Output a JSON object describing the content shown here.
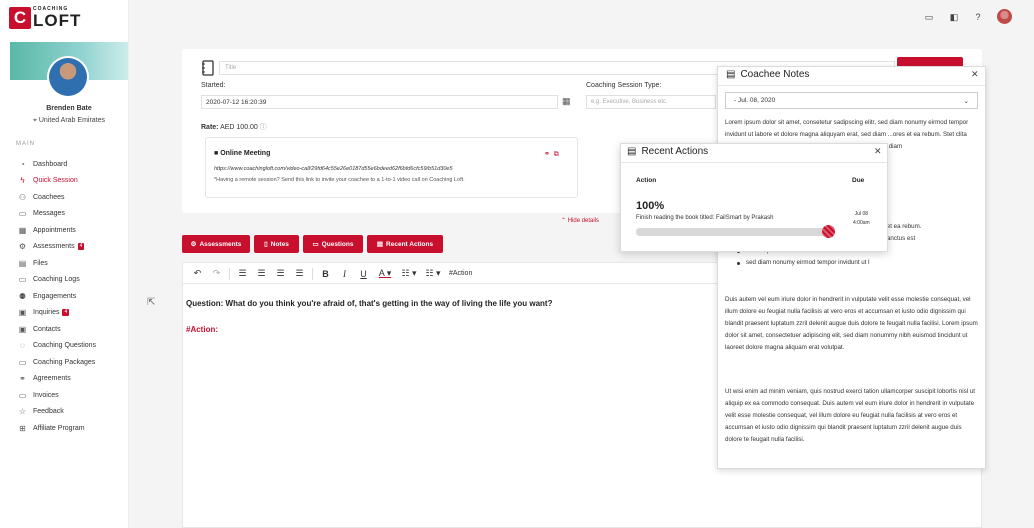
{
  "brand": {
    "mark": "C",
    "line1": "COACHING",
    "line2": "LOFT"
  },
  "user": {
    "name": "Brenden Bate",
    "location": "United Arab Emirates"
  },
  "sidebar": {
    "section": "MAIN",
    "items": [
      {
        "label": "Dashboard",
        "icon": "dashboard-icon"
      },
      {
        "label": "Quick Session",
        "icon": "bolt-icon"
      },
      {
        "label": "Coachees",
        "icon": "coachees-icon"
      },
      {
        "label": "Messages",
        "icon": "chat-icon"
      },
      {
        "label": "Appointments",
        "icon": "calendar-icon"
      },
      {
        "label": "Assessments",
        "icon": "assessment-icon",
        "badge": "4"
      },
      {
        "label": "Files",
        "icon": "folder-icon"
      },
      {
        "label": "Coaching Logs",
        "icon": "log-icon"
      },
      {
        "label": "Engagements",
        "icon": "users-icon"
      },
      {
        "label": "Inquiries",
        "icon": "inbox-icon",
        "badge": "4"
      },
      {
        "label": "Contacts",
        "icon": "contacts-icon"
      },
      {
        "label": "Coaching Questions",
        "icon": "question-icon"
      },
      {
        "label": "Coaching Packages",
        "icon": "package-icon"
      },
      {
        "label": "Agreements",
        "icon": "handshake-icon"
      },
      {
        "label": "Invoices",
        "icon": "invoice-icon"
      },
      {
        "label": "Feedback",
        "icon": "star-icon"
      },
      {
        "label": "Affiliate Program",
        "icon": "affiliate-icon"
      }
    ]
  },
  "session": {
    "title_placeholder": "Title",
    "started_label": "Started:",
    "started_value": "2020-07-12 16:20:39",
    "type_label": "Coaching Session Type:",
    "type_placeholder": "e.g. Executive, Business etc.",
    "rate_label": "Rate:",
    "rate_value": "AED 100.00",
    "meeting_title": "Online Meeting",
    "meeting_url": "https://www.coachingloft.com/video-call/29fd64c55e26e0187d55e6bdeed62f6bfd6cfc59/b51d30e5",
    "meeting_hint": "*Having a remote session? Send this link to invite your coachee to a 1-to-1 video call on Coaching Loft.",
    "hide_details": "Hide details"
  },
  "buttons": {
    "assessments": "Assessments",
    "notes": "Notes",
    "questions": "Questions",
    "recent_actions": "Recent Actions"
  },
  "editor": {
    "toolbar_tag": "#Action",
    "question": "Question: What do you think you're afraid of, that's getting in the way of living the life you want?",
    "action_tag": "#Action:"
  },
  "coachee_notes": {
    "title": "Coachee Notes",
    "selected_date": "- Jul. 08, 2020",
    "p1": "Lorem ipsum dolor sit amet, consetetur sadipscing elitr, sed diam nonumy eirmod tempor invidunt ut labore et dolore magna aliquyam erat, sed diam ...ores et ea rebum. Stet clita ...ipsum dolor sit amet. ...elitr, sed diam nonumy ...erat, sed diam",
    "list_partial_1": "ores et ea rebum.",
    "list_partial_2": "ta sanctus est",
    "list_item_1": "Lorem ipsum dolor sit amet.",
    "list_item_2": "sed diam nonumy eirmod tempor invidunt ut l",
    "p3": "Duis autem vel eum iriure dolor in hendrerit in vulputate velit esse molestie consequat, vel illum dolore eu feugiat nulla facilisis at vero eros et accumsan et iusto odio dignissim qui blandit praesent luptatum zzril delenit augue duis dolore te feugait nulla facilisi. Lorem ipsum dolor sit amet, consectetuer adipiscing elit, sed diam nonummy nibh euismod tincidunt ut laoreet dolore magna aliquam erat volutpat.",
    "p4": "Ut wisi enim ad minim veniam, quis nostrud exerci tation ullamcorper suscipit lobortis nisl ut aliquip ex ea commodo consequat. Duis autem vel eum iriure dolor in hendrerit in vulputate velit esse molestie consequat, vel illum dolore eu feugiat nulla facilisis at vero eros et accumsan et iusto odio dignissim qui blandit praesent luptatum zzril delenit augue duis dolore te feugait nulla facilisi."
  },
  "recent_actions": {
    "title": "Recent Actions",
    "col_action": "Action",
    "col_due": "Due",
    "percent": "100%",
    "progress": 1.0,
    "description": "Finish reading the book titled: FailSmart by Prakash",
    "due_date": "Jul 08",
    "due_time": "4:00am"
  },
  "colors": {
    "accent": "#c8102e",
    "banner": "#8fd3d0"
  }
}
